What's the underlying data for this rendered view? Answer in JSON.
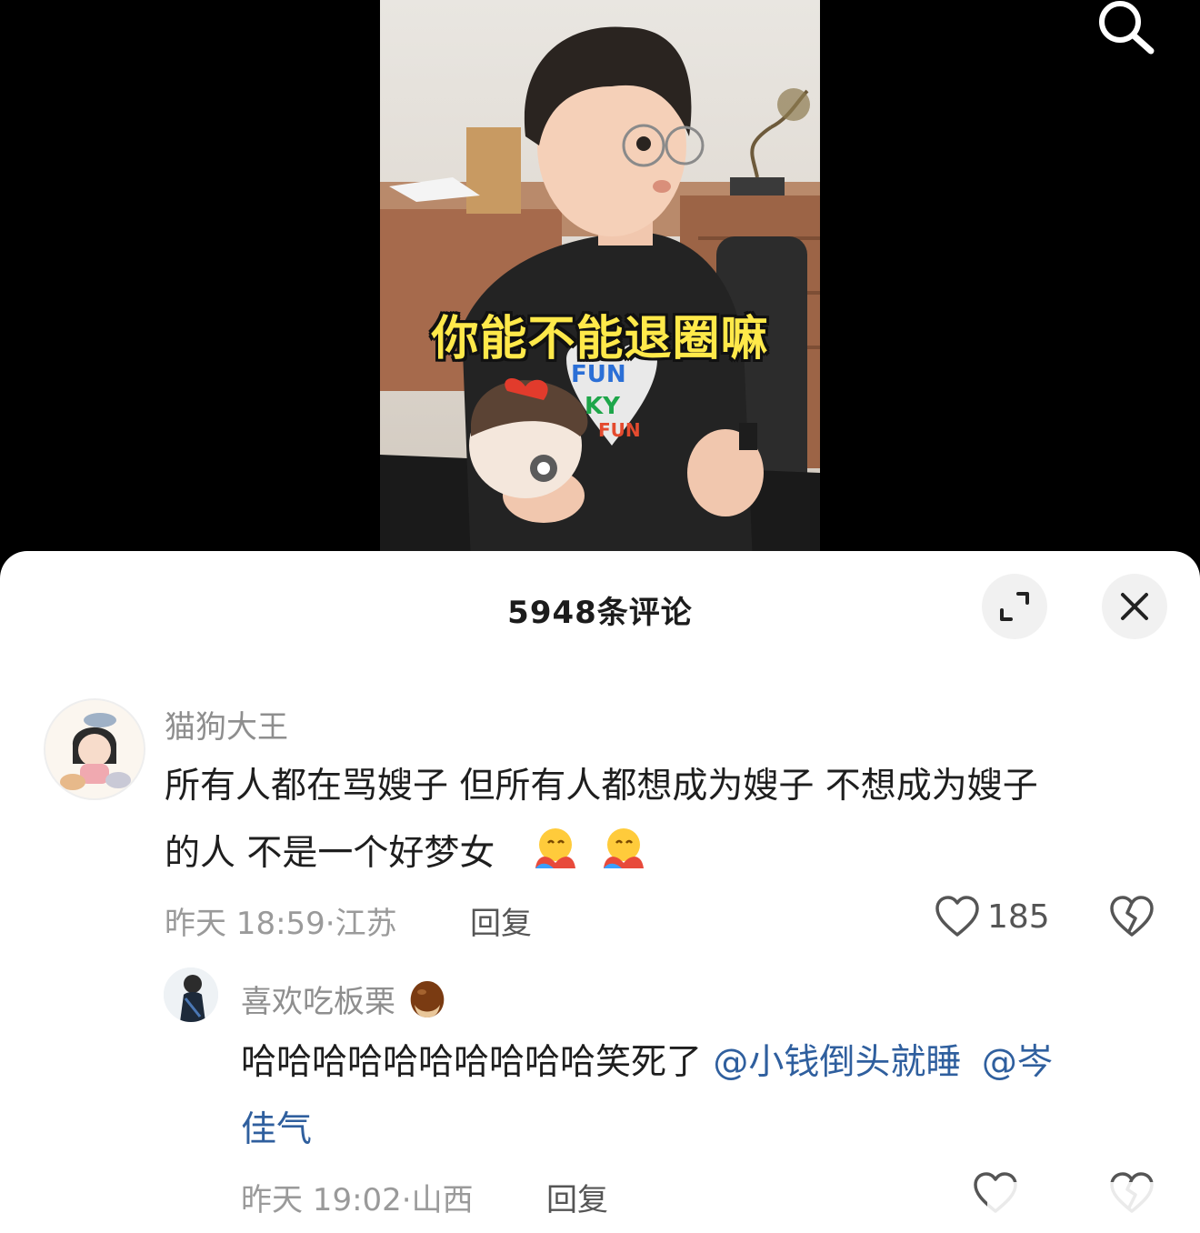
{
  "video": {
    "caption": "你能不能退圈嘛"
  },
  "comments_panel": {
    "title": "5948条评论",
    "expand_label": "expand-icon",
    "close_label": "close-icon"
  },
  "comments": [
    {
      "username": "猫狗大王",
      "text_line1": "所有人都在骂嫂子 但所有人都想成为嫂子 不想成为嫂子",
      "text_line2": "的人 不是一个好梦女",
      "emojis": [
        "hugging-face-emoji",
        "hugging-face-emoji"
      ],
      "time": "昨天 18:59",
      "location": "江苏",
      "reply_label": "回复",
      "likes": "185"
    },
    {
      "username": "喜欢吃板栗",
      "username_emoji": "chestnut-emoji",
      "text": "哈哈哈哈哈哈哈哈哈哈笑死了",
      "mention1": "@小钱倒头就睡",
      "mention2_part1": "@岑",
      "mention2_part2": "佳气",
      "time": "昨天 19:02",
      "location": "山西",
      "reply_label": "回复"
    }
  ],
  "icons": {
    "search": "search-icon",
    "like": "heart-icon",
    "dislike": "broken-heart-icon"
  }
}
